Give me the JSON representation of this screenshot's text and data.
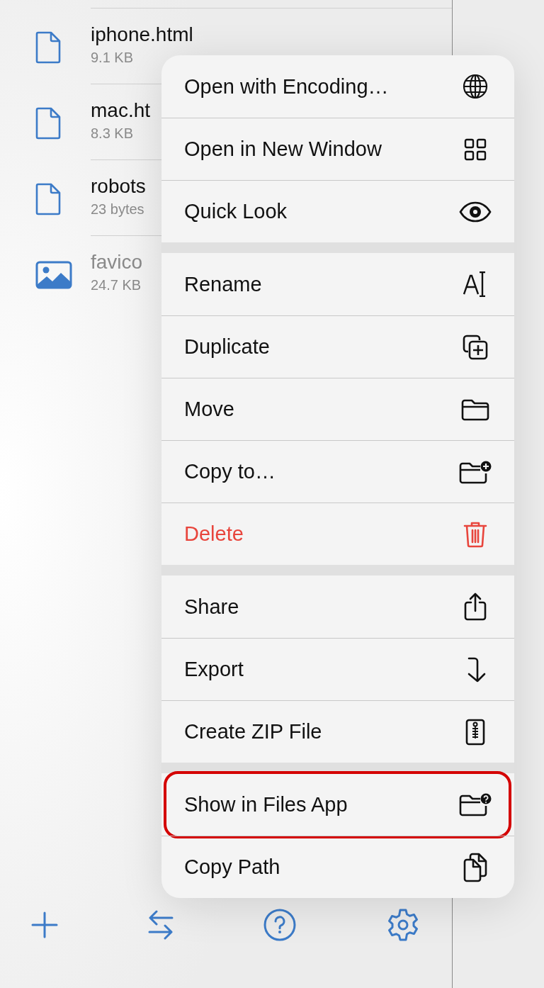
{
  "files": [
    {
      "name": "iphone.html",
      "size": "9.1 KB",
      "kind": "document",
      "disabled": false
    },
    {
      "name": "mac.ht",
      "size": "8.3 KB",
      "kind": "document",
      "disabled": false
    },
    {
      "name": "robots",
      "size": "23 bytes",
      "kind": "document",
      "disabled": false
    },
    {
      "name": "favico",
      "size": "24.7 KB",
      "kind": "image",
      "disabled": true
    }
  ],
  "context_menu": {
    "groups": [
      {
        "items": [
          {
            "label": "Open with Encoding…",
            "destructive": false,
            "highlighted": false
          },
          {
            "label": "Open in New Window",
            "destructive": false,
            "highlighted": false
          },
          {
            "label": "Quick Look",
            "destructive": false,
            "highlighted": false
          }
        ]
      },
      {
        "items": [
          {
            "label": "Rename",
            "destructive": false,
            "highlighted": false
          },
          {
            "label": "Duplicate",
            "destructive": false,
            "highlighted": false
          },
          {
            "label": "Move",
            "destructive": false,
            "highlighted": false
          },
          {
            "label": "Copy to…",
            "destructive": false,
            "highlighted": false
          },
          {
            "label": "Delete",
            "destructive": true,
            "highlighted": false
          }
        ]
      },
      {
        "items": [
          {
            "label": "Share",
            "destructive": false,
            "highlighted": false
          },
          {
            "label": "Export",
            "destructive": false,
            "highlighted": false
          },
          {
            "label": "Create ZIP File",
            "destructive": false,
            "highlighted": false
          }
        ]
      },
      {
        "items": [
          {
            "label": "Show in Files App",
            "destructive": false,
            "highlighted": true
          },
          {
            "label": "Copy Path",
            "destructive": false,
            "highlighted": false
          }
        ]
      }
    ]
  }
}
